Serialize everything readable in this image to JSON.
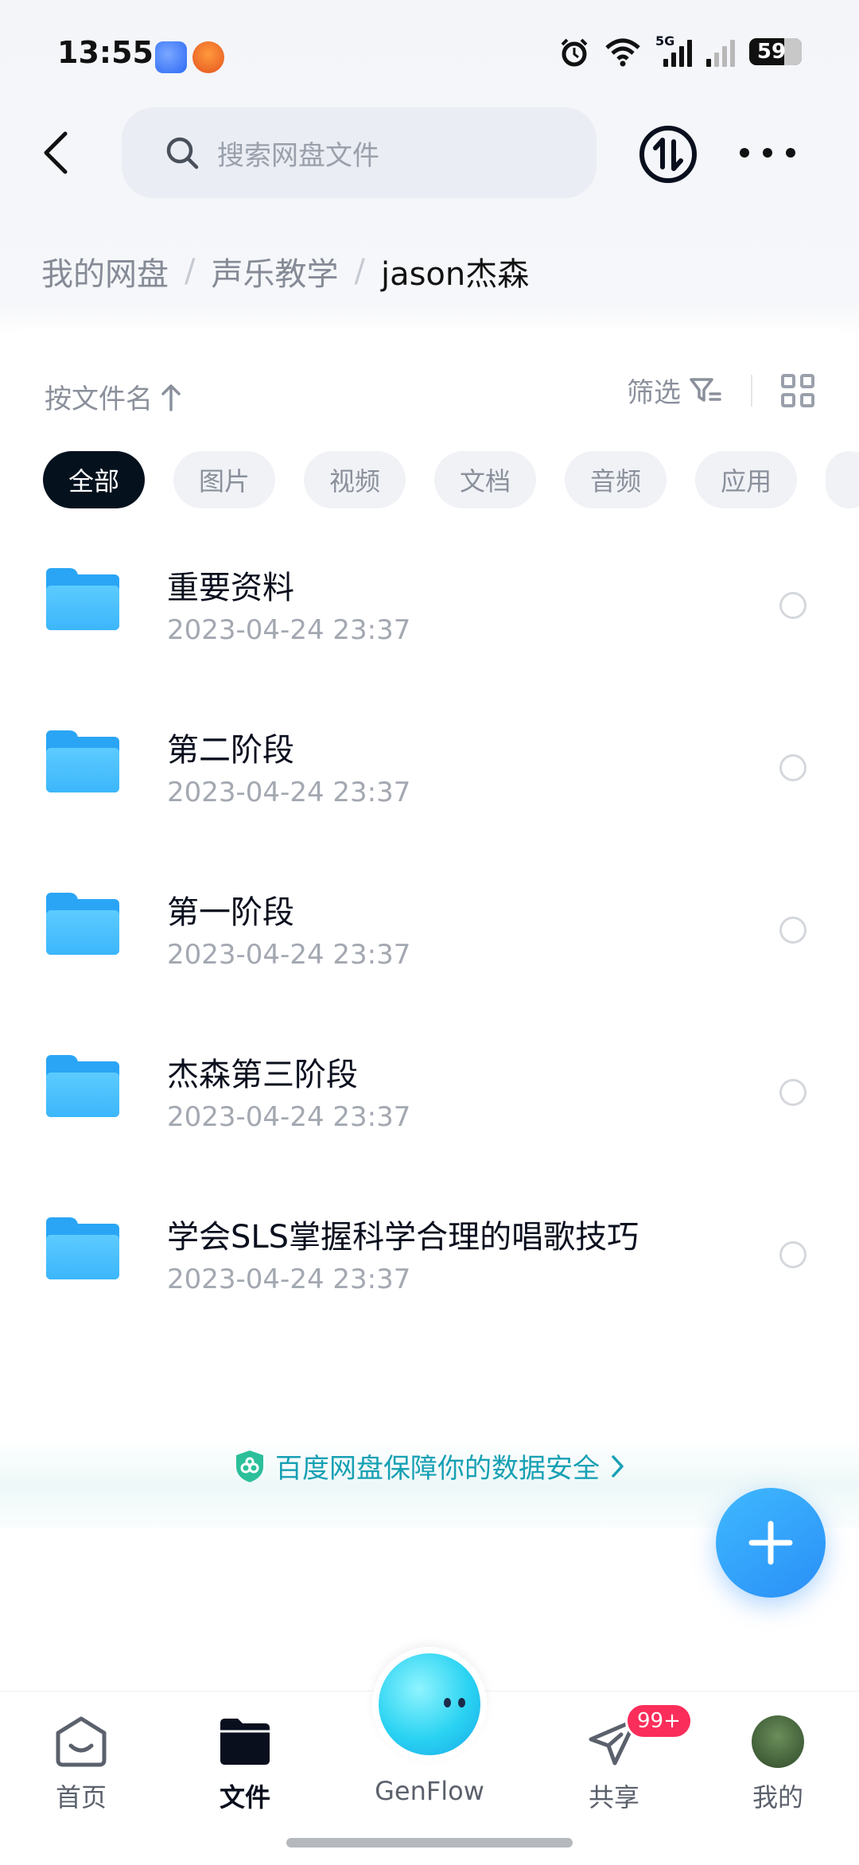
{
  "status_bar": {
    "time": "13:55",
    "network_label": "5G",
    "battery_level": "59",
    "icons": [
      "genflow-app-icon",
      "notification-app-icon",
      "alarm-icon",
      "wifi-icon",
      "signal-icon",
      "signal-icon-weak",
      "battery-icon"
    ]
  },
  "header": {
    "search_placeholder": "搜索网盘文件"
  },
  "breadcrumb": {
    "items": [
      "我的网盘",
      "声乐教学"
    ],
    "current": "jason杰森"
  },
  "toolbar": {
    "sort_label": "按文件名",
    "filter_label": "筛选"
  },
  "chips": [
    {
      "label": "全部",
      "active": true
    },
    {
      "label": "图片",
      "active": false
    },
    {
      "label": "视频",
      "active": false
    },
    {
      "label": "文档",
      "active": false
    },
    {
      "label": "音频",
      "active": false
    },
    {
      "label": "应用",
      "active": false
    }
  ],
  "files": [
    {
      "name": "重要资料",
      "date": "2023-04-24  23:37"
    },
    {
      "name": "第二阶段",
      "date": "2023-04-24  23:37"
    },
    {
      "name": "第一阶段",
      "date": "2023-04-24  23:37"
    },
    {
      "name": "杰森第三阶段",
      "date": "2023-04-24  23:37"
    },
    {
      "name": "学会SLS掌握科学合理的唱歌技巧",
      "date": "2023-04-24  23:37"
    }
  ],
  "security_note": "百度网盘保障你的数据安全",
  "tabs": {
    "home": "首页",
    "files": "文件",
    "genflow": "GenFlow",
    "share": "共享",
    "mine": "我的",
    "share_badge": "99+"
  },
  "colors": {
    "accent": "#2a9bf7",
    "active_chip": "#06111e",
    "security_text": "#17a0b4",
    "badge": "#fb2d5a"
  }
}
